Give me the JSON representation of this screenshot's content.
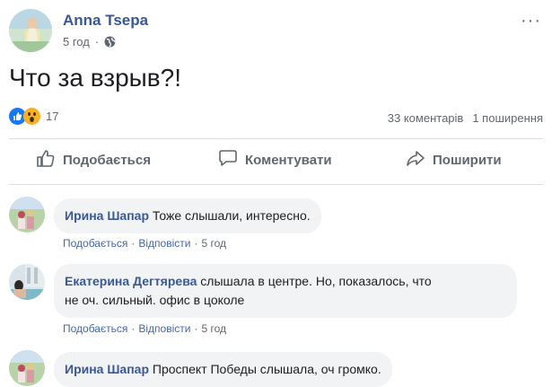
{
  "post": {
    "author": "Anna Tsepa",
    "time": "5 год",
    "separator": "·",
    "text": "Что за взрыв?!",
    "reactions_count": "17",
    "comments_count": "33 коментарів",
    "shares_count": "1 поширення",
    "more_label": "···"
  },
  "actions": {
    "like": "Подобається",
    "comment": "Коментувати",
    "share": "Поширити"
  },
  "comments": [
    {
      "name": "Ирина Шапар",
      "text": "Тоже слышали, интересно.",
      "like": "Подобається",
      "reply": "Відповісти",
      "sep": "·",
      "time": "5 год"
    },
    {
      "name": "Екатерина Дегтярева",
      "text_line1": "слышала в центре. Но, показалось, что",
      "text_line2": "не оч. сильный. офис в цоколе",
      "like": "Подобається",
      "reply": "Відповісти",
      "sep": "·",
      "time": "5 год"
    },
    {
      "name": "Ирина Шапар",
      "text": "Проспект Победы слышала, оч громко."
    }
  ],
  "colors": {
    "link_blue": "#385898",
    "action_grey": "#606770",
    "bubble_bg": "#f2f3f5",
    "like_blue": "#1877f2",
    "wow_yellow": "#f7b125"
  }
}
